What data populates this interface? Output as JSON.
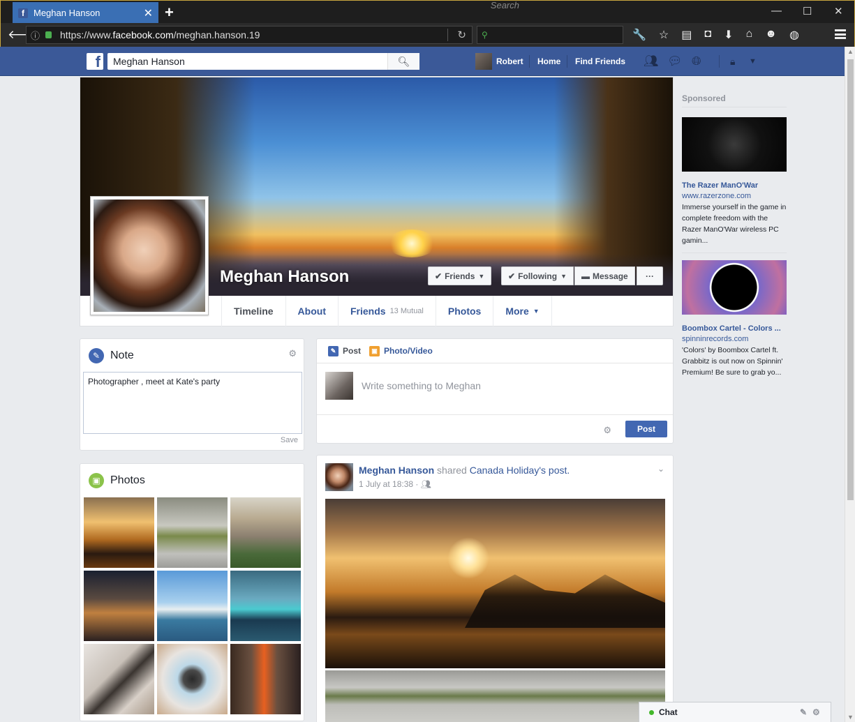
{
  "browser": {
    "tab_title": "Meghan Hanson",
    "tab_favicon": "f",
    "url_prefix": "https://www.",
    "url_domain": "facebook.com",
    "url_path": "/meghan.hanson.19",
    "search_placeholder": "Search"
  },
  "fb": {
    "logo": "f",
    "search_value": "Meghan Hanson",
    "user_name": "Robert",
    "nav_home": "Home",
    "nav_find_friends": "Find Friends",
    "brand_color": "#3b5998"
  },
  "profile": {
    "name": "Meghan Hanson",
    "btn_friends": "Friends",
    "btn_following": "Following",
    "btn_message": "Message",
    "btn_more": "···",
    "tabs": {
      "timeline": "Timeline",
      "about": "About",
      "friends": "Friends",
      "friends_mutual": "13 Mutual",
      "photos": "Photos",
      "more": "More"
    }
  },
  "note": {
    "title": "Note",
    "text": "Photographer , meet at Kate's party",
    "save": "Save"
  },
  "photos": {
    "title": "Photos"
  },
  "composer": {
    "tab_post": "Post",
    "tab_photo_video": "Photo/Video",
    "placeholder": "Write something to Meghan",
    "post_button": "Post"
  },
  "story": {
    "author": "Meghan Hanson",
    "verb": "shared",
    "page": "Canada Holiday's",
    "object": "post.",
    "meta": "1 July at 18:38 ·"
  },
  "sidebar": {
    "sponsored": "Sponsored",
    "ads": [
      {
        "title": "The Razer ManO'War",
        "url": "www.razerzone.com",
        "desc": "Immerse yourself in the game in complete freedom with the Razer ManO'War wireless PC gamin..."
      },
      {
        "title": "Boombox Cartel - Colors ...",
        "url": "spinninrecords.com",
        "desc": "'Colors' by Boombox Cartel ft. Grabbitz is out now on Spinnin' Premium! Be sure to grab yo..."
      }
    ]
  },
  "chat": {
    "label": "Chat"
  }
}
